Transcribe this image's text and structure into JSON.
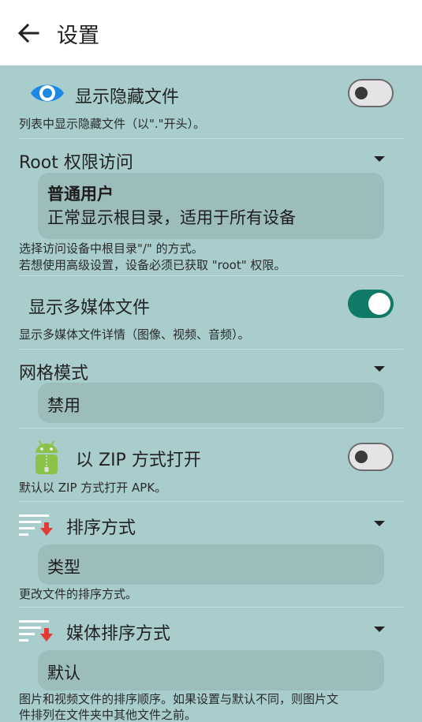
{
  "header": {
    "title": "设置"
  },
  "settings": {
    "hidden_files": {
      "label": "显示隐藏文件",
      "desc": "列表中显示隐藏文件（以\".\"开头）。",
      "enabled": false
    },
    "root": {
      "label": "Root 权限访问",
      "value_title": "普通用户",
      "value_desc": "正常显示根目录，适用于所有设备",
      "desc_line1": "选择访问设备中根目录\"/\" 的方式。",
      "desc_line2": "若想使用高级设置，设备必须已获取 \"root\" 权限。"
    },
    "media": {
      "label": "显示多媒体文件",
      "desc": "显示多媒体文件详情（图像、视频、音频）。",
      "enabled": true
    },
    "grid": {
      "label": "网格模式",
      "value": "禁用"
    },
    "zip": {
      "label": "以 ZIP 方式打开",
      "desc": "默认以 ZIP 方式打开 APK。",
      "enabled": false
    },
    "sort": {
      "label": "排序方式",
      "value": "类型",
      "desc": "更改文件的排序方式。"
    },
    "media_sort": {
      "label": "媒体排序方式",
      "value": "默认",
      "desc_line1": "图片和视频文件的排序顺序。如果设置与默认不同，则图片文",
      "desc_line2": "件排列在文件夹中其他文件之前。"
    }
  },
  "colors": {
    "background": "#a9cdcd",
    "accent": "#0f7a66",
    "eye_icon": "#1e88e5",
    "android_icon": "#8bc34a",
    "sort_arrow": "#e53935"
  }
}
